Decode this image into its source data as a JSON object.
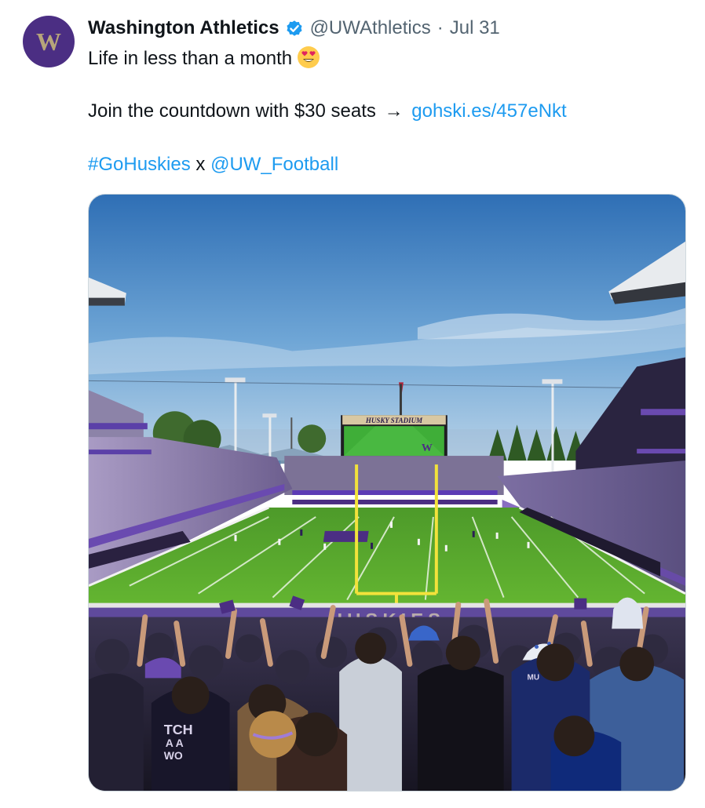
{
  "author": {
    "display_name": "Washington Athletics",
    "handle": "@UWAthletics",
    "separator": "·",
    "date": "Jul 31",
    "avatar_icon": "uw-w-logo-icon",
    "verified_icon": "verified-badge-icon",
    "avatar_letter": "W"
  },
  "tweet": {
    "line1_text": "Life in less than a month",
    "line1_emoji": "smiling-face-with-heart-eyes-emoji",
    "line2_text": "Join the countdown with $30 seats",
    "line2_arrow": "→",
    "line2_link": "gohski.es/457eNkt",
    "line3_hashtag": "#GoHuskies",
    "line3_separator": "x",
    "line3_mention": "@UW_Football"
  },
  "media": {
    "scoreboard_text": "HUSKY STADIUM",
    "endzone_text": "HUSKIES",
    "shirt_text_1": "TCH",
    "shirt_text_2": "A A",
    "shirt_text_3": "WO",
    "shirt_text_4": "MU"
  },
  "colors": {
    "link": "#1d9bf0",
    "uw_purple": "#4b2e83",
    "uw_gold": "#b7a57a",
    "verified_blue": "#1d9bf0",
    "secondary_text": "#536471"
  }
}
